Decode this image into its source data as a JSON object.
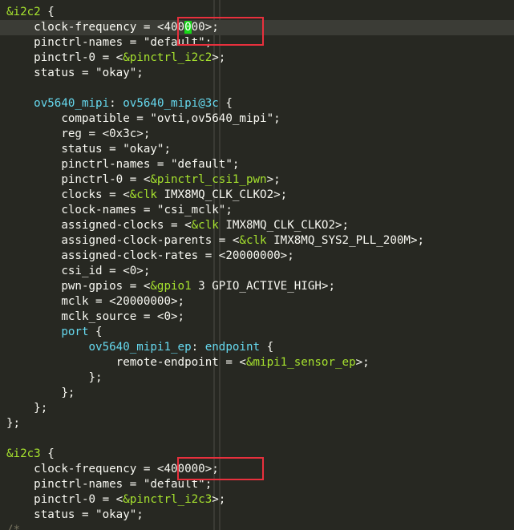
{
  "editor": {
    "lines": [
      [
        {
          "t": "&i2c2",
          "c": "tok-ref"
        },
        {
          "t": " {",
          "c": "tok-punc"
        }
      ],
      [
        {
          "t": "    clock-frequency = <400",
          "c": "tok-text"
        },
        {
          "t": "0",
          "c": "cursor-char"
        },
        {
          "t": "00>;",
          "c": "tok-text"
        }
      ],
      [
        {
          "t": "    pinctrl-names = \"default\";",
          "c": "tok-text"
        }
      ],
      [
        {
          "t": "    pinctrl-0 = <",
          "c": "tok-text"
        },
        {
          "t": "&pinctrl_i2c2",
          "c": "tok-ref"
        },
        {
          "t": ">;",
          "c": "tok-text"
        }
      ],
      [
        {
          "t": "    status = \"okay\";",
          "c": "tok-text"
        }
      ],
      [],
      [
        {
          "t": "    ",
          "c": "tok-text"
        },
        {
          "t": "ov5640_mipi",
          "c": "tok-label"
        },
        {
          "t": ": ",
          "c": "tok-text"
        },
        {
          "t": "ov5640_mipi@3c",
          "c": "tok-label"
        },
        {
          "t": " {",
          "c": "tok-punc"
        }
      ],
      [
        {
          "t": "        compatible = \"ovti,ov5640_mipi\";",
          "c": "tok-text"
        }
      ],
      [
        {
          "t": "        reg = <0x3c>;",
          "c": "tok-text"
        }
      ],
      [
        {
          "t": "        status = \"okay\";",
          "c": "tok-text"
        }
      ],
      [
        {
          "t": "        pinctrl-names = \"default\";",
          "c": "tok-text"
        }
      ],
      [
        {
          "t": "        pinctrl-0 = <",
          "c": "tok-text"
        },
        {
          "t": "&pinctrl_csi1_pwn",
          "c": "tok-ref"
        },
        {
          "t": ">;",
          "c": "tok-text"
        }
      ],
      [
        {
          "t": "        clocks = <",
          "c": "tok-text"
        },
        {
          "t": "&clk",
          "c": "tok-ref"
        },
        {
          "t": " IMX8MQ_CLK_CLKO2>;",
          "c": "tok-text"
        }
      ],
      [
        {
          "t": "        clock-names = \"csi_mclk\";",
          "c": "tok-text"
        }
      ],
      [
        {
          "t": "        assigned-clocks = <",
          "c": "tok-text"
        },
        {
          "t": "&clk",
          "c": "tok-ref"
        },
        {
          "t": " IMX8MQ_CLK_CLKO2>;",
          "c": "tok-text"
        }
      ],
      [
        {
          "t": "        assigned-clock-parents = <",
          "c": "tok-text"
        },
        {
          "t": "&clk",
          "c": "tok-ref"
        },
        {
          "t": " IMX8MQ_SYS2_PLL_200M>;",
          "c": "tok-text"
        }
      ],
      [
        {
          "t": "        assigned-clock-rates = <20000000>;",
          "c": "tok-text"
        }
      ],
      [
        {
          "t": "        csi_id = <0>;",
          "c": "tok-text"
        }
      ],
      [
        {
          "t": "        pwn-gpios = <",
          "c": "tok-text"
        },
        {
          "t": "&gpio1",
          "c": "tok-ref"
        },
        {
          "t": " 3 GPIO_ACTIVE_HIGH>;",
          "c": "tok-text"
        }
      ],
      [
        {
          "t": "        mclk = <20000000>;",
          "c": "tok-text"
        }
      ],
      [
        {
          "t": "        mclk_source = <0>;",
          "c": "tok-text"
        }
      ],
      [
        {
          "t": "        ",
          "c": "tok-text"
        },
        {
          "t": "port",
          "c": "tok-label"
        },
        {
          "t": " {",
          "c": "tok-punc"
        }
      ],
      [
        {
          "t": "            ",
          "c": "tok-text"
        },
        {
          "t": "ov5640_mipi1_ep",
          "c": "tok-label"
        },
        {
          "t": ": ",
          "c": "tok-text"
        },
        {
          "t": "endpoint",
          "c": "tok-label"
        },
        {
          "t": " {",
          "c": "tok-punc"
        }
      ],
      [
        {
          "t": "                remote-endpoint = <",
          "c": "tok-text"
        },
        {
          "t": "&mipi1_sensor_ep",
          "c": "tok-ref"
        },
        {
          "t": ">;",
          "c": "tok-text"
        }
      ],
      [
        {
          "t": "            };",
          "c": "tok-punc"
        }
      ],
      [
        {
          "t": "        };",
          "c": "tok-punc"
        }
      ],
      [
        {
          "t": "    };",
          "c": "tok-punc"
        }
      ],
      [
        {
          "t": "};",
          "c": "tok-punc"
        }
      ],
      [],
      [
        {
          "t": "&i2c3",
          "c": "tok-ref"
        },
        {
          "t": " {",
          "c": "tok-punc"
        }
      ],
      [
        {
          "t": "    clock-frequency = <400000>;",
          "c": "tok-text"
        }
      ],
      [
        {
          "t": "    pinctrl-names = \"default\";",
          "c": "tok-text"
        }
      ],
      [
        {
          "t": "    pinctrl-0 = <",
          "c": "tok-text"
        },
        {
          "t": "&pinctrl_i2c3",
          "c": "tok-ref"
        },
        {
          "t": ">;",
          "c": "tok-text"
        }
      ],
      [
        {
          "t": "    status = \"okay\";",
          "c": "tok-text"
        }
      ],
      [
        {
          "t": "/*",
          "c": "tok-comment"
        }
      ]
    ],
    "current_line": 1
  },
  "colors": {
    "background": "#272822",
    "highlight_box": "#e8303d",
    "cursor": "#18d818"
  }
}
